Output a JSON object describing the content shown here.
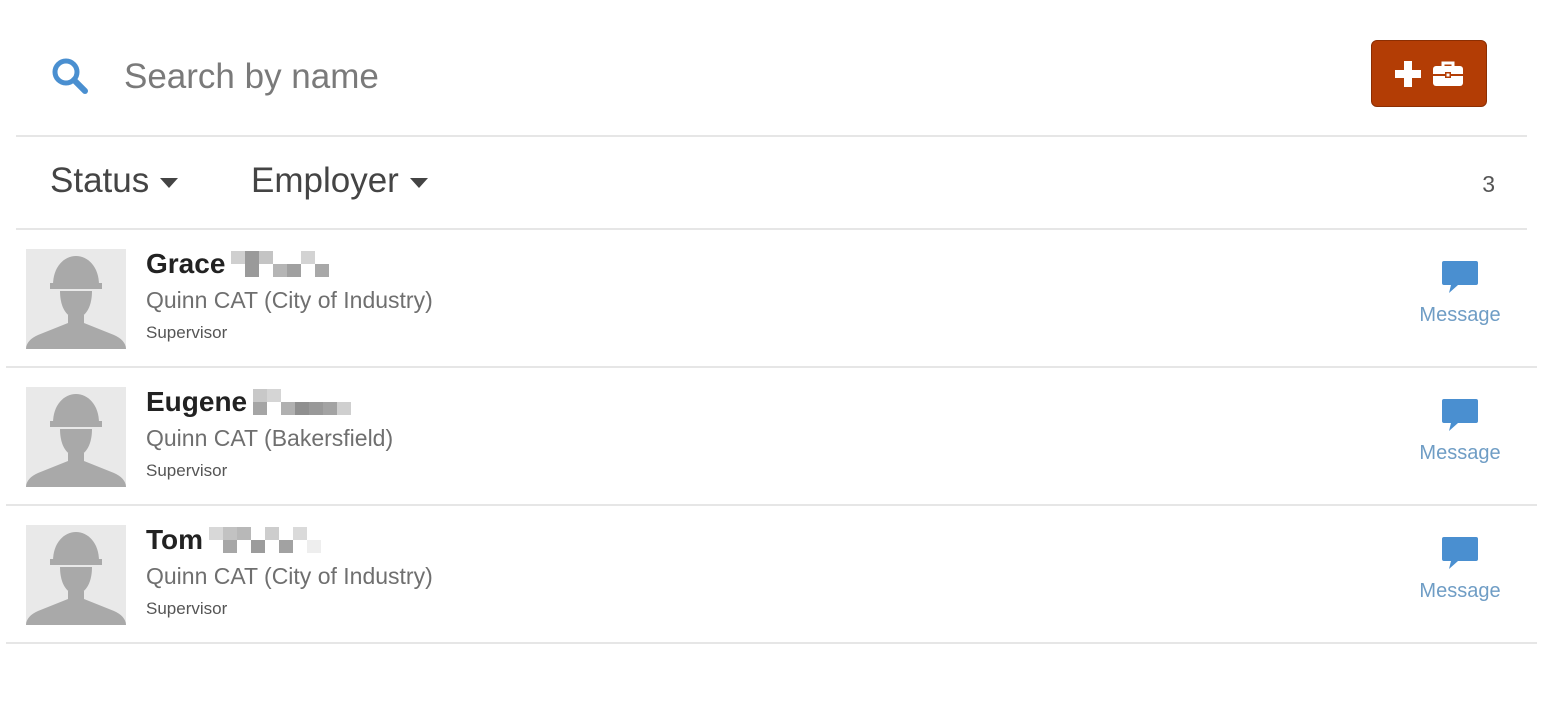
{
  "search": {
    "placeholder": "Search by name",
    "value": ""
  },
  "toolbar": {
    "add_button_icons": [
      "plus-icon",
      "briefcase-icon"
    ],
    "accent_color": "#b33d05"
  },
  "filters": [
    {
      "label": "Status"
    },
    {
      "label": "Employer"
    }
  ],
  "result_count": "3",
  "people": [
    {
      "first_name": "Grace",
      "employer": "Quinn CAT (City of Industry)",
      "role": "Supervisor",
      "action_label": "Message"
    },
    {
      "first_name": "Eugene",
      "employer": "Quinn CAT (Bakersfield)",
      "role": "Supervisor",
      "action_label": "Message"
    },
    {
      "first_name": "Tom",
      "employer": "Quinn CAT (City of Industry)",
      "role": "Supervisor",
      "action_label": "Message"
    }
  ],
  "colors": {
    "link": "#6f9dc5",
    "message_icon": "#4a8fd0",
    "search_icon": "#4a8fd0"
  }
}
